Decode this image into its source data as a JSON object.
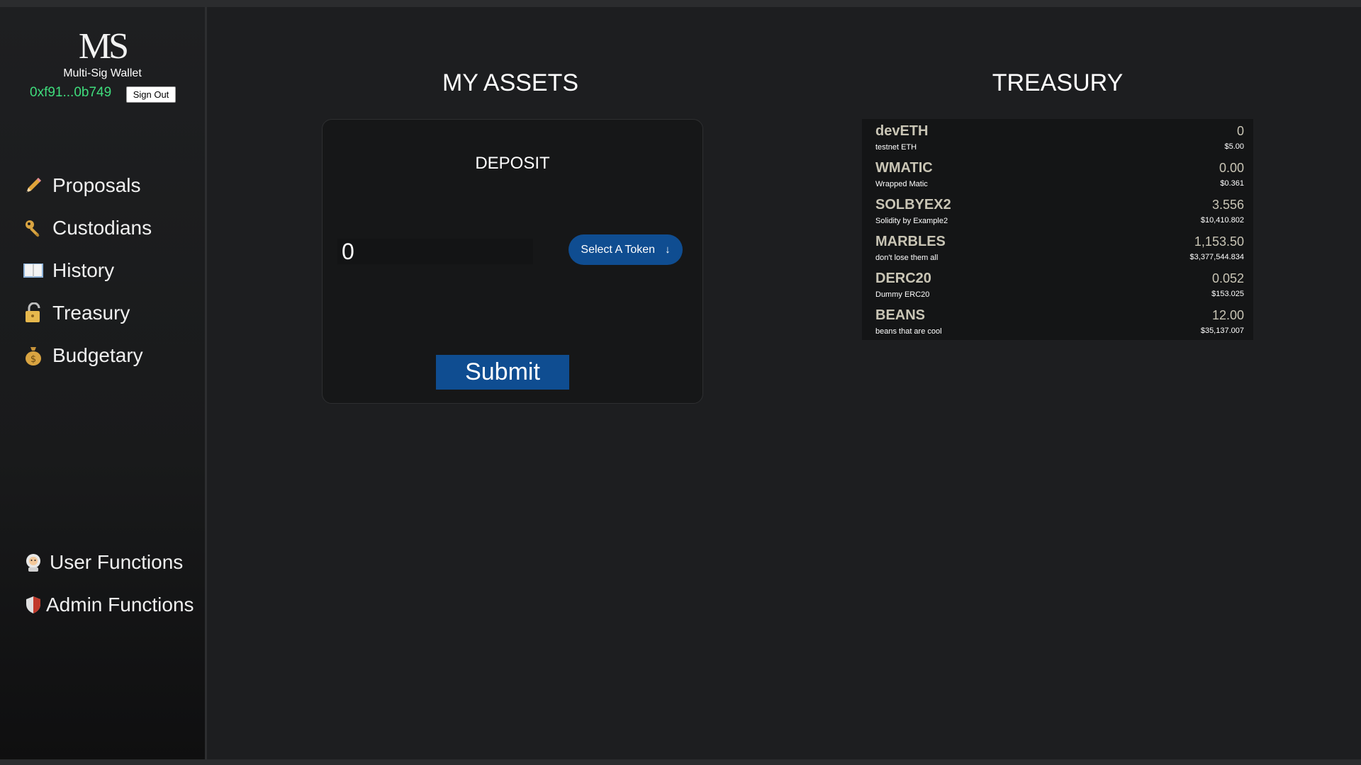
{
  "sidebar": {
    "logo": "MS",
    "app_name": "Multi-Sig Wallet",
    "address": "0xf91...0b749",
    "sign_out": "Sign Out",
    "nav": [
      {
        "label": "Proposals",
        "icon": "pencil-icon"
      },
      {
        "label": "Custodians",
        "icon": "key-icon"
      },
      {
        "label": "History",
        "icon": "book-icon"
      },
      {
        "label": "Treasury",
        "icon": "lock-icon"
      },
      {
        "label": "Budgetary",
        "icon": "money-bag-icon"
      }
    ],
    "bottom_nav": [
      {
        "label": "User Functions",
        "icon": "astronaut-icon"
      },
      {
        "label": "Admin Functions",
        "icon": "shield-icon"
      }
    ]
  },
  "assets": {
    "title": "MY ASSETS",
    "deposit_title": "DEPOSIT",
    "amount_value": "0",
    "token_select_label": "Select A Token",
    "token_select_arrow": "↓",
    "submit_label": "Submit"
  },
  "treasury": {
    "title": "TREASURY",
    "tokens": [
      {
        "symbol": "devETH",
        "name": "testnet ETH",
        "amount": "0",
        "usd": "$5.00"
      },
      {
        "symbol": "WMATIC",
        "name": "Wrapped Matic",
        "amount": "0.00",
        "usd": "$0.361"
      },
      {
        "symbol": "SOLBYEX2",
        "name": "Solidity by Example2",
        "amount": "3.556",
        "usd": "$10,410.802"
      },
      {
        "symbol": "MARBLES",
        "name": "don't lose them all",
        "amount": "1,153.50",
        "usd": "$3,377,544.834"
      },
      {
        "symbol": "DERC20",
        "name": "Dummy ERC20",
        "amount": "0.052",
        "usd": "$153.025"
      },
      {
        "symbol": "BEANS",
        "name": "beans that are cool",
        "amount": "12.00",
        "usd": "$35,137.007"
      }
    ]
  },
  "colors": {
    "accent_blue": "#0f4d91",
    "address_green": "#3fdc7c",
    "token_symbol": "#c9c5b5"
  }
}
